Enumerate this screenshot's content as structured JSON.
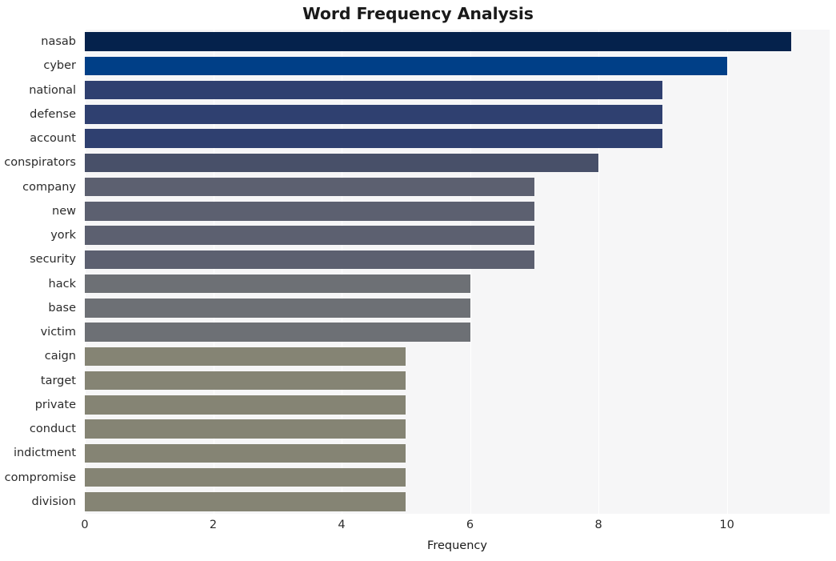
{
  "chart_data": {
    "type": "bar",
    "orientation": "horizontal",
    "title": "Word Frequency Analysis",
    "xlabel": "Frequency",
    "ylabel": "",
    "xlim": [
      0,
      11.6
    ],
    "xticks": [
      0,
      2,
      4,
      6,
      8,
      10
    ],
    "xtick_labels": [
      "0",
      "2",
      "4",
      "6",
      "8",
      "10"
    ],
    "grid": true,
    "grid_axis": "x",
    "legend": null,
    "categories": [
      "nasab",
      "cyber",
      "national",
      "defense",
      "account",
      "conspirators",
      "company",
      "new",
      "york",
      "security",
      "hack",
      "base",
      "victim",
      "caign",
      "target",
      "private",
      "conduct",
      "indictment",
      "compromise",
      "division"
    ],
    "values": [
      11,
      10,
      9,
      9,
      9,
      8,
      7,
      7,
      7,
      7,
      6,
      6,
      6,
      5,
      5,
      5,
      5,
      5,
      5,
      5
    ],
    "bar_colors": [
      "#05224c",
      "#003f87",
      "#2f4070",
      "#2f4070",
      "#2f4070",
      "#485069",
      "#5c6070",
      "#5c6070",
      "#5c6070",
      "#5c6070",
      "#6d7075",
      "#6d7075",
      "#6d7075",
      "#858474",
      "#858474",
      "#858474",
      "#858474",
      "#858474",
      "#858474",
      "#858474"
    ],
    "plot_background": "#f6f6f7",
    "figure_background": "#ffffff",
    "gridline_color": "#ffffff",
    "text_color": "#2b2b2b"
  },
  "axis": {
    "x_title": "Frequency"
  }
}
